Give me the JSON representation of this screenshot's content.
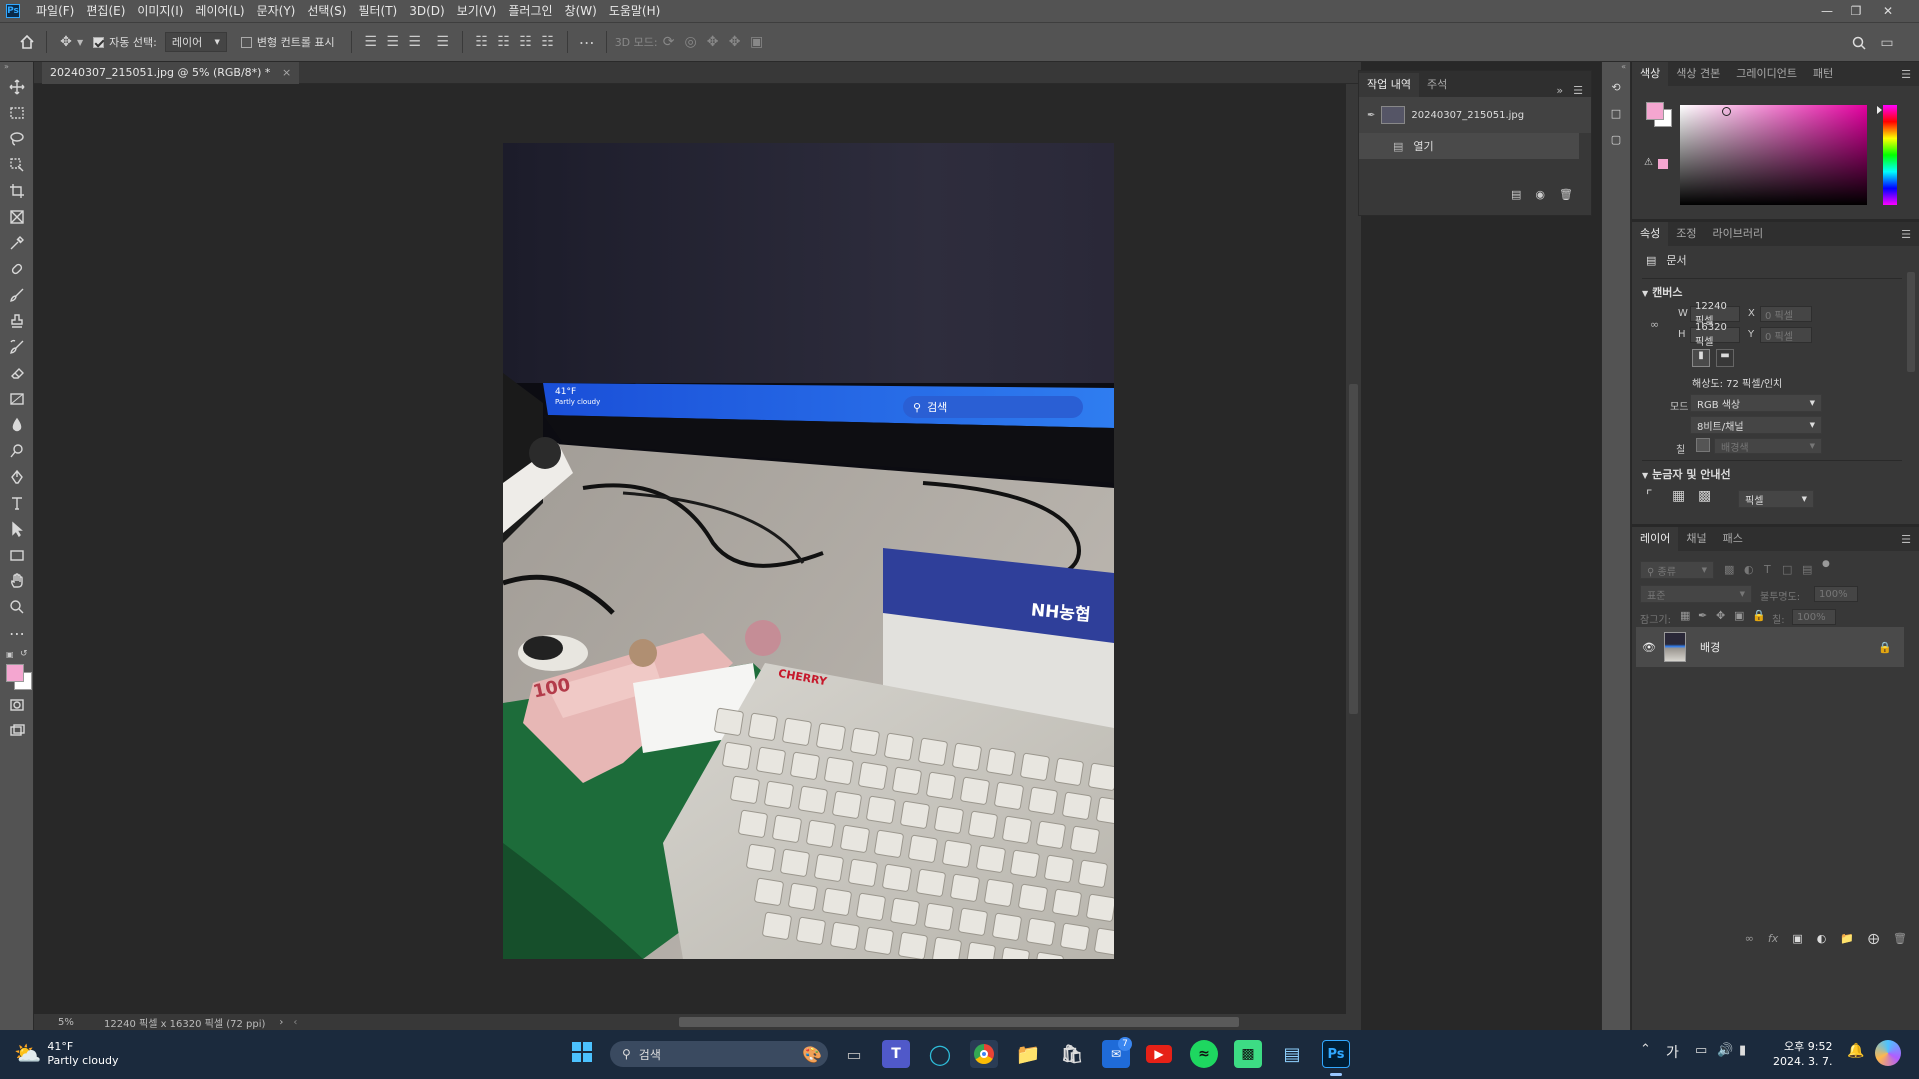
{
  "menu": {
    "logo": "Ps",
    "items": [
      "파일(F)",
      "편집(E)",
      "이미지(I)",
      "레이어(L)",
      "문자(Y)",
      "선택(S)",
      "필터(T)",
      "3D(D)",
      "보기(V)",
      "플러그인",
      "창(W)",
      "도움말(H)"
    ]
  },
  "options": {
    "auto_select_label": "자동 선택:",
    "auto_select_value": "레이어",
    "transform_label": "변형 컨트롤 표시",
    "mode3d_label": "3D 모드:"
  },
  "document": {
    "tab_title": "20240307_215051.jpg @ 5% (RGB/8*) *",
    "zoom": "5%",
    "info": "12240 픽셀 x 16320 픽셀 (72 ppi)"
  },
  "photo_screen": {
    "weather": "41°F",
    "weather_sub": "Partly cloudy",
    "search": "검색"
  },
  "photo_keyboard": {
    "brand": "CHERRY",
    "box_text": "NH농협",
    "bill": "100"
  },
  "history": {
    "tabs": [
      "작업 내역",
      "주석"
    ],
    "snapshot": "20240307_215051.jpg",
    "step": "열기"
  },
  "color_panel": {
    "tabs": [
      "색상",
      "색상 견본",
      "그레이디언트",
      "패턴"
    ],
    "fg": "#f4a6d0",
    "bg": "#ffffff"
  },
  "properties": {
    "tabs": [
      "속성",
      "조정",
      "라이브러리"
    ],
    "doc_label": "문서",
    "canvas_header": "캔버스",
    "w_label": "W",
    "w_value": "12240 픽셀",
    "h_label": "H",
    "h_value": "16320 픽셀",
    "x_label": "X",
    "x_value": "0 픽셀",
    "y_label": "Y",
    "y_value": "0 픽셀",
    "resolution": "해상도: 72 픽셀/인치",
    "mode_label": "모드",
    "mode_value": "RGB 색상",
    "depth_value": "8비트/채널",
    "fill_label": "칠",
    "fill_value": "배경색",
    "rulers_header": "눈금자 및 안내선",
    "unit_value": "픽셀"
  },
  "layers": {
    "tabs": [
      "레이어",
      "채널",
      "패스"
    ],
    "filter_placeholder": "종류",
    "blend": "표준",
    "opacity_label": "불투명도:",
    "opacity_value": "100%",
    "lock_label": "잠그기:",
    "fill_label": "칠:",
    "fill_value": "100%",
    "layer_name": "배경"
  },
  "taskbar": {
    "weather_temp": "41°F",
    "weather_desc": "Partly cloudy",
    "search": "검색",
    "ime": "가",
    "time": "오후 9:52",
    "date": "2024. 3. 7.",
    "badge": "7"
  }
}
